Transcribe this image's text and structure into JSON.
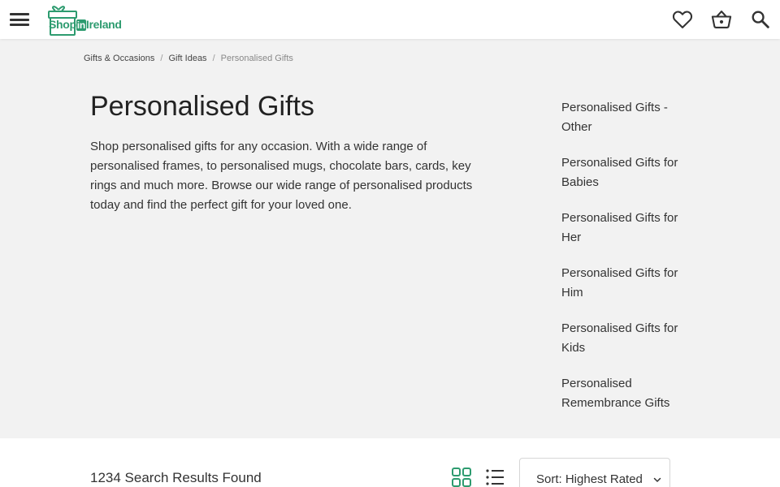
{
  "header": {
    "logo": {
      "part1": "Shop",
      "part2": "in",
      "part3": "Ireland"
    },
    "icons": [
      "menu-icon",
      "heart-icon",
      "basket-icon",
      "search-icon"
    ]
  },
  "breadcrumb": {
    "items": [
      "Gifts & Occasions",
      "Gift Ideas"
    ],
    "current": "Personalised Gifts",
    "separator": "/"
  },
  "main": {
    "title": "Personalised Gifts",
    "description": "Shop personalised gifts for any occasion. With a wide range of personalised frames, to personalised mugs, chocolate bars, cards, key rings and much more. Browse our wide range of personalised products today and find the perfect gift for your loved one."
  },
  "subcategories": [
    "Personalised Gifts - Other",
    "Personalised Gifts for Babies",
    "Personalised Gifts for Her",
    "Personalised Gifts for Him",
    "Personalised Gifts for Kids",
    "Personalised Remembrance Gifts"
  ],
  "results": {
    "count_text": "1234 Search Results Found",
    "sort_label": "Sort: Highest Rated",
    "active_view": "grid"
  },
  "colors": {
    "brand_green": "#2d9b6f",
    "hero_bg": "#f2f2f2",
    "text": "#222222"
  }
}
